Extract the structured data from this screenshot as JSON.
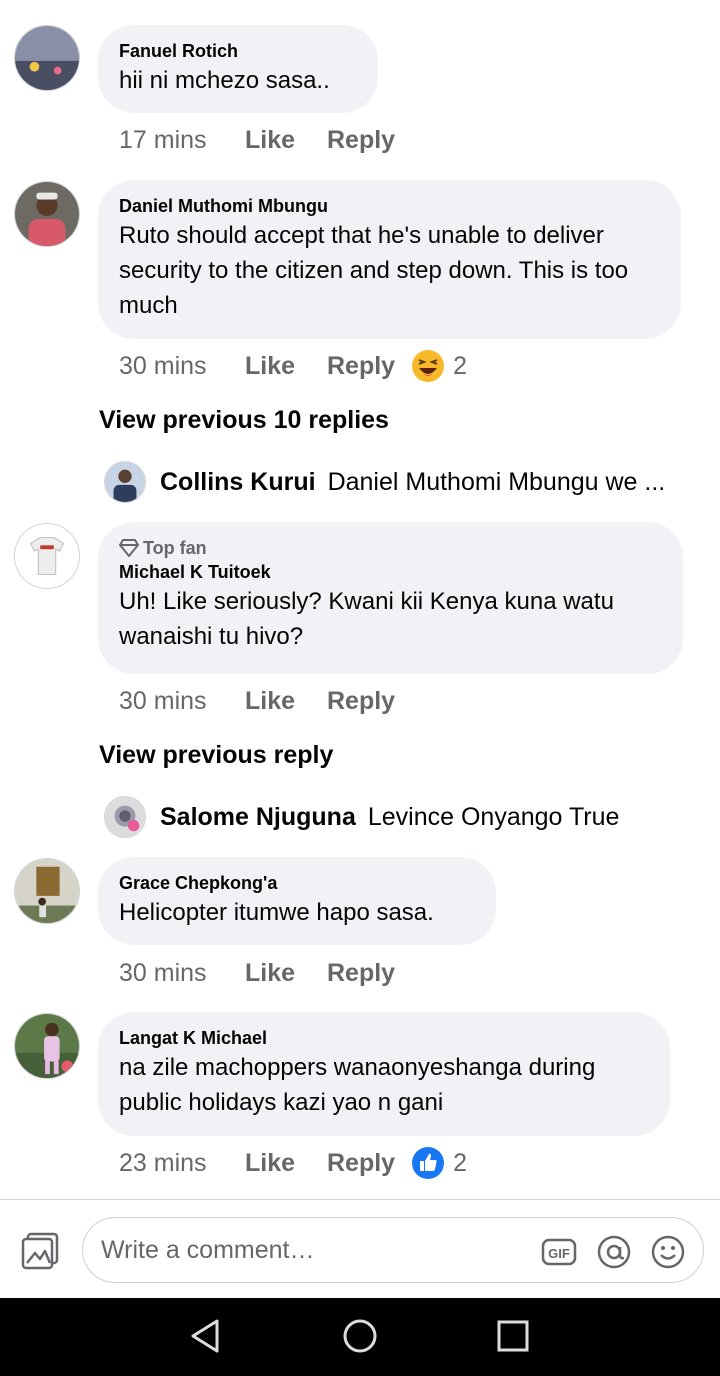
{
  "comments": [
    {
      "author": "Fanuel Rotich",
      "text": "hii ni mchezo sasa..",
      "time": "17 mins",
      "like": "Like",
      "reply": "Reply"
    },
    {
      "author": "Daniel Muthomi Mbungu",
      "text": "Ruto should accept that he's unable to deliver security to the citizen and step down. This is too much",
      "time": "30 mins",
      "like": "Like",
      "reply": "Reply",
      "reaction_count": "2",
      "reaction_icon": "laugh-emoji-icon"
    },
    {
      "badge": "Top fan",
      "author": "Michael K Tuitoek",
      "text": "Uh! Like seriously? Kwani kii Kenya kuna watu wanaishi tu hivo?",
      "time": "30 mins",
      "like": "Like",
      "reply": "Reply"
    },
    {
      "author": "Grace Chepkong'a",
      "text": "Helicopter itumwe hapo sasa.",
      "time": "30 mins",
      "like": "Like",
      "reply": "Reply"
    },
    {
      "author": "Langat K Michael",
      "text": "na zile machoppers wanaonyeshanga during public holidays kazi yao n gani",
      "time": "23 mins",
      "like": "Like",
      "reply": "Reply",
      "reaction_count": "2",
      "reaction_icon": "thumbs-up-icon"
    }
  ],
  "threads": [
    {
      "view_previous": "View previous 10 replies",
      "reply_author": "Collins Kurui",
      "reply_text": "Daniel Muthomi Mbungu we ..."
    },
    {
      "view_previous": "View previous reply",
      "reply_author": "Salome Njuguna",
      "reply_text": "Levince Onyango True"
    }
  ],
  "composer": {
    "placeholder": "Write a comment…",
    "icons": [
      "gallery-icon",
      "gif-icon",
      "mention-icon",
      "emoji-icon"
    ]
  },
  "navbar": {
    "icons": [
      "back-icon",
      "home-icon",
      "recents-icon"
    ]
  },
  "colors": {
    "bubble": "#f0f2f5",
    "meta": "#65676b",
    "like_blue": "#1877f2",
    "laugh_yellow": "#f7b928"
  }
}
